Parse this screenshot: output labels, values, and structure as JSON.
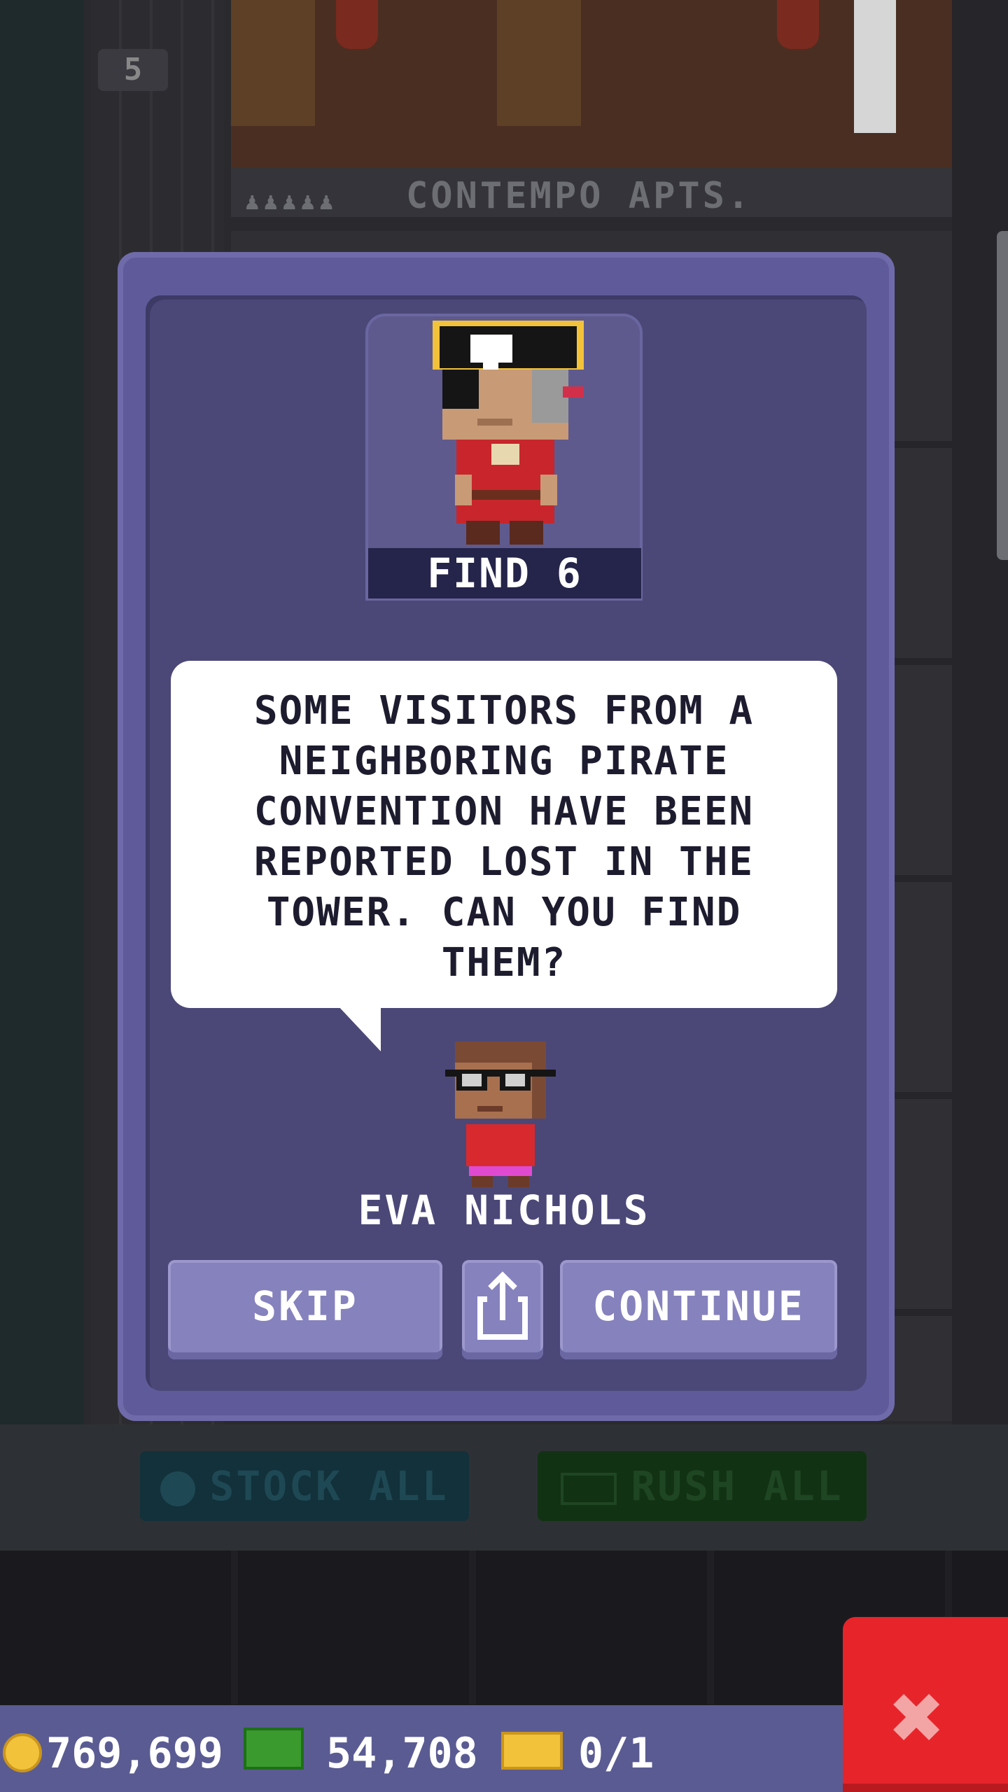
{
  "background": {
    "floor_number": "5",
    "floor_name": "CONTEMPO APTS.",
    "floor_residents": "♟♟♟♟♟",
    "toolbar": {
      "stock_all": "STOCK ALL",
      "rush_all": "RUSH ALL"
    }
  },
  "status_bar": {
    "coins": "769,699",
    "bux": "54,708",
    "tickets": "0/1"
  },
  "dialog": {
    "mission_label": "FIND 6",
    "message": "SOME VISITORS FROM A\nNEIGHBORING PIRATE\nCONVENTION HAVE BEEN\nREPORTED LOST IN THE\nTOWER. CAN YOU FIND\nTHEM?",
    "npc_name": "EVA NICHOLS",
    "buttons": {
      "skip": "SKIP",
      "continue": "CONTINUE"
    }
  },
  "icons": {
    "coin": "coin-icon",
    "bux": "bux-icon",
    "ticket": "ticket-icon",
    "share": "share-icon",
    "close": "close-icon"
  },
  "colors": {
    "dialog_bg": "#4b4878",
    "dialog_frame": "#5f5b9a",
    "button": "#8682bd",
    "close": "#e8242b",
    "status_bar": "#5b5b93"
  }
}
